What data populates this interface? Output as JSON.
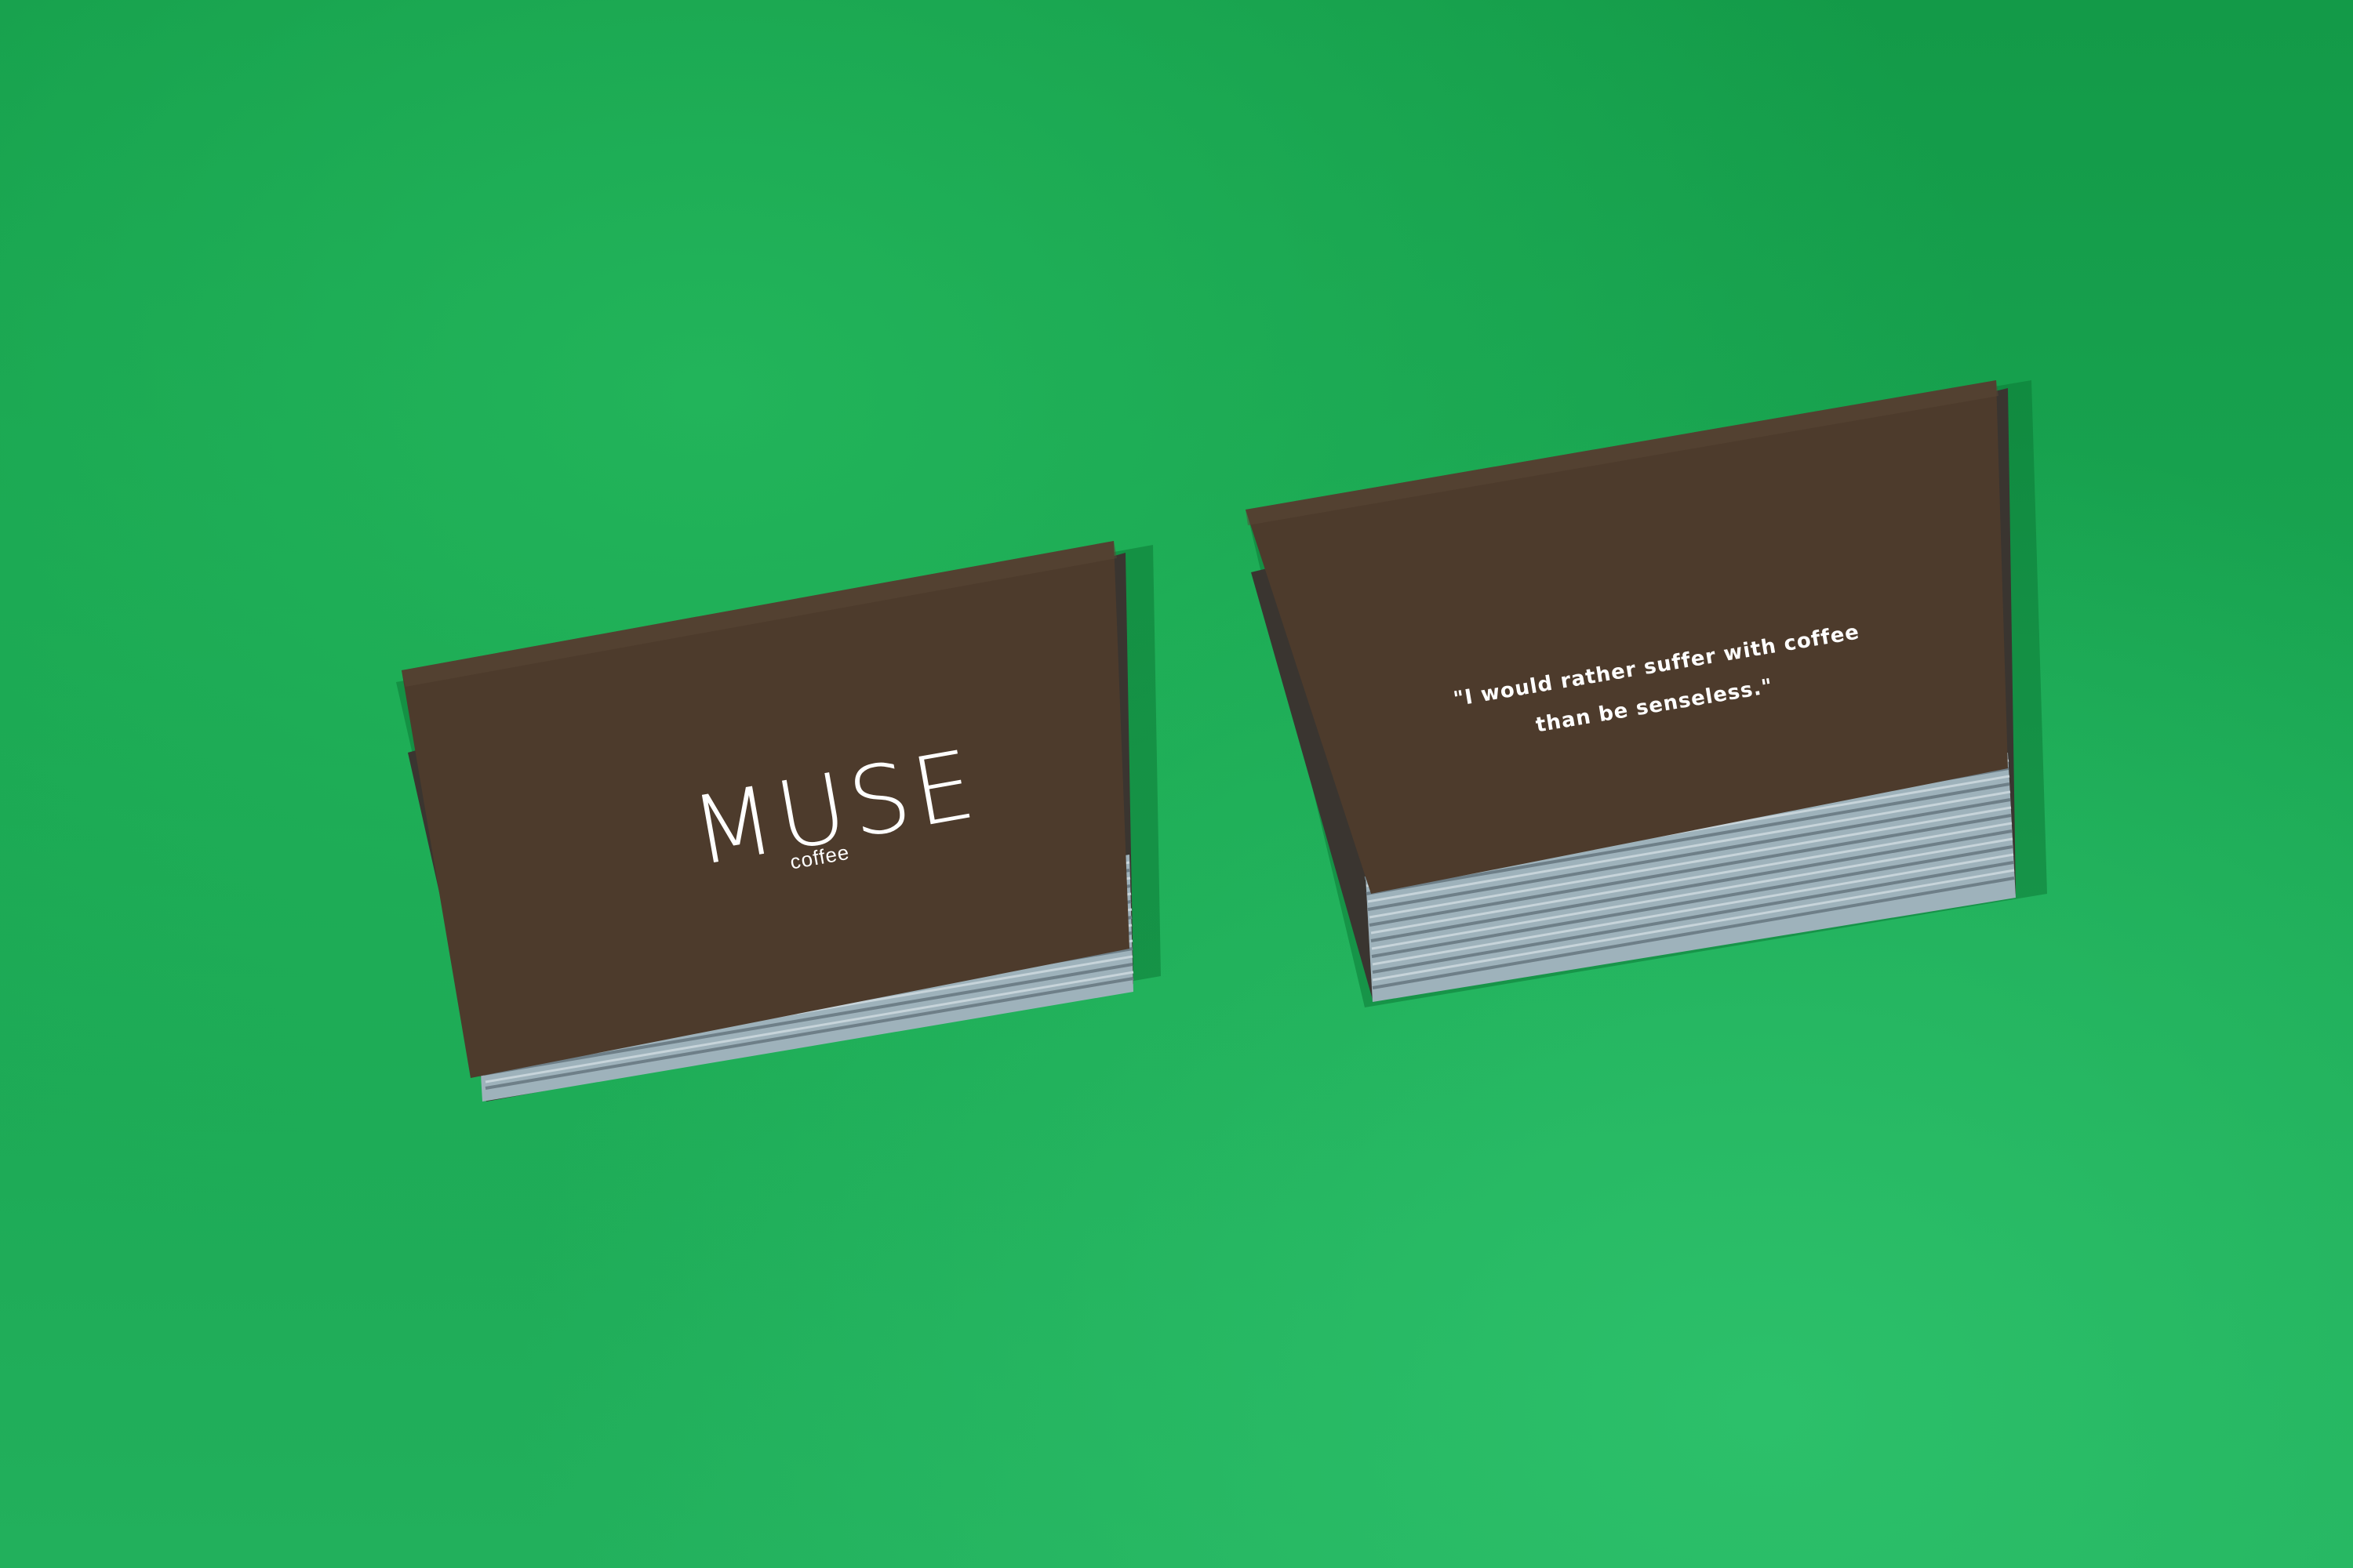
{
  "left_card": {
    "logo_word": "MUSE",
    "logo_subtitle": "coffee"
  },
  "right_card": {
    "quote_line_1": "\"I would rather suffer with coffee",
    "quote_line_2": "than be senseless.\""
  },
  "colors": {
    "background": "#1aa34f",
    "card_face": "#4b3a2c",
    "card_edge": "#8fa2ac",
    "text": "#ffffff"
  }
}
